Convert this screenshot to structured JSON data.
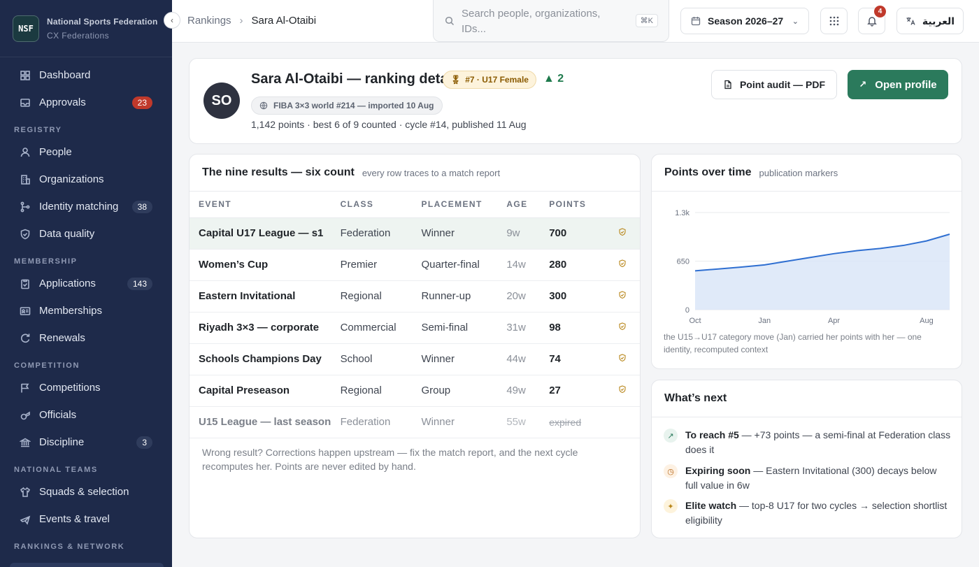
{
  "brand": {
    "logo": "NSF",
    "name": "National Sports Federation",
    "sub": "CX Federations"
  },
  "sidebar": {
    "top": [
      {
        "label": "Dashboard",
        "icon": "dashboard-icon"
      },
      {
        "label": "Approvals",
        "icon": "inbox-icon",
        "badge": "23"
      }
    ],
    "sections": [
      {
        "title": "REGISTRY",
        "items": [
          {
            "label": "People",
            "icon": "person-icon"
          },
          {
            "label": "Organizations",
            "icon": "building-icon"
          },
          {
            "label": "Identity matching",
            "icon": "merge-icon",
            "badge": "38"
          },
          {
            "label": "Data quality",
            "icon": "shield-check-icon"
          }
        ]
      },
      {
        "title": "MEMBERSHIP",
        "items": [
          {
            "label": "Applications",
            "icon": "clipboard-icon",
            "badge": "143"
          },
          {
            "label": "Memberships",
            "icon": "id-card-icon"
          },
          {
            "label": "Renewals",
            "icon": "refresh-icon"
          }
        ]
      },
      {
        "title": "COMPETITION",
        "items": [
          {
            "label": "Competitions",
            "icon": "flag-icon"
          },
          {
            "label": "Officials",
            "icon": "whistle-icon"
          },
          {
            "label": "Discipline",
            "icon": "bank-icon",
            "badge": "3"
          }
        ]
      },
      {
        "title": "NATIONAL TEAMS",
        "items": [
          {
            "label": "Squads & selection",
            "icon": "shirt-icon"
          },
          {
            "label": "Events & travel",
            "icon": "plane-icon"
          }
        ]
      },
      {
        "title": "RANKINGS & NETWORK",
        "items": []
      }
    ]
  },
  "topbar": {
    "breadcrumb": [
      "Rankings",
      "Sara Al-Otaibi"
    ],
    "search_placeholder": "Search people, organizations, IDs...",
    "search_kbd": "⌘K",
    "season": "Season 2026–27",
    "notif_count": "4",
    "language": "العربية"
  },
  "profile": {
    "initials": "SO",
    "title": "Sara Al-Otaibi — ranking detail",
    "rank_pill": "#7 · U17 Female",
    "delta": "▲ 2",
    "fiba": "FIBA 3×3 world #214 — imported 10 Aug",
    "meta": "1,142 points · best 6 of 9 counted · cycle #14, published 11 Aug",
    "audit_button": "Point audit — PDF",
    "open_button": "Open profile"
  },
  "results": {
    "title": "The nine results — six count",
    "subtitle": "every row traces to a match report",
    "columns": [
      "EVENT",
      "CLASS",
      "PLACEMENT",
      "AGE",
      "POINTS"
    ],
    "rows": [
      {
        "event": "Capital U17 League — s1",
        "class": "Federation",
        "placement": "Winner",
        "age": "9w",
        "points": "700"
      },
      {
        "event": "Women’s Cup",
        "class": "Premier",
        "placement": "Quarter-final",
        "age": "14w",
        "points": "280"
      },
      {
        "event": "Eastern Invitational",
        "class": "Regional",
        "placement": "Runner-up",
        "age": "20w",
        "points": "300"
      },
      {
        "event": "Riyadh 3×3 — corporate",
        "class": "Commercial",
        "placement": "Semi-final",
        "age": "31w",
        "points": "98"
      },
      {
        "event": "Schools Champions Day",
        "class": "School",
        "placement": "Winner",
        "age": "44w",
        "points": "74"
      },
      {
        "event": "Capital Preseason",
        "class": "Regional",
        "placement": "Group",
        "age": "49w",
        "points": "27"
      },
      {
        "event": "U15 League — last season",
        "class": "Federation",
        "placement": "Winner",
        "age": "55w",
        "points": "expired"
      }
    ],
    "footnote": "Wrong result? Corrections happen upstream — fix the match report, and the next cycle recomputes her. Points are never edited by hand."
  },
  "chart": {
    "title": "Points over time",
    "subtitle": "publication markers",
    "note": "the U15→U17 category move (Jan) carried her points with her — one identity, recomputed context"
  },
  "chart_data": {
    "type": "area",
    "x": [
      "Oct",
      "Nov",
      "Dec",
      "Jan",
      "Feb",
      "Mar",
      "Apr",
      "May",
      "Jun",
      "Jul",
      "Aug",
      "Sep"
    ],
    "values": [
      520,
      545,
      570,
      600,
      650,
      700,
      750,
      790,
      820,
      860,
      920,
      1010
    ],
    "x_ticks": [
      "Oct",
      "Jan",
      "Apr",
      "Aug"
    ],
    "y_ticks": [
      "0",
      "650",
      "1.3k"
    ],
    "ylim": [
      0,
      1300
    ],
    "color": "#2f6fd1",
    "grid": true
  },
  "next": {
    "title": "What’s next",
    "items": [
      {
        "icon": "trend-up-icon",
        "lead": "To reach #5",
        "text": " — +73 points — a semi-final at Federation class does it",
        "bg": "#e8f3ee",
        "fg": "#2b7a5c"
      },
      {
        "icon": "clock-icon",
        "lead": "Expiring soon",
        "text": " — Eastern Invitational (300) decays below full value in 6w",
        "bg": "#fdf1e3",
        "fg": "#b8681a"
      },
      {
        "icon": "sparkle-icon",
        "lead": "Elite watch",
        "text": " — top-8 U17 for two cycles → selection shortlist eligibility",
        "bg": "#fdf3dc",
        "fg": "#b8861a"
      }
    ]
  }
}
